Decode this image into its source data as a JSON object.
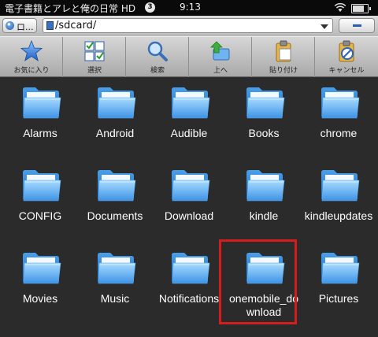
{
  "status_bar": {
    "title": "電子書籍とアレと俺の日常 HD",
    "badge": "3",
    "time": "9:13"
  },
  "address_bar": {
    "drive_label": "ロ...",
    "path": "/sdcard/"
  },
  "toolbar": {
    "buttons": [
      {
        "label": "お気に入り",
        "icon": "star-icon"
      },
      {
        "label": "選択",
        "icon": "checklist-icon"
      },
      {
        "label": "検索",
        "icon": "magnifier-icon"
      },
      {
        "label": "上へ",
        "icon": "up-folder-icon"
      },
      {
        "label": "貼り付け",
        "icon": "clipboard-icon"
      },
      {
        "label": "キャンセル",
        "icon": "cancel-icon"
      }
    ]
  },
  "folders": [
    {
      "name": "Alarms"
    },
    {
      "name": "Android"
    },
    {
      "name": "Audible"
    },
    {
      "name": "Books"
    },
    {
      "name": "chrome"
    },
    {
      "name": "CONFIG"
    },
    {
      "name": "Documents"
    },
    {
      "name": "Download"
    },
    {
      "name": "kindle"
    },
    {
      "name": "kindleupdates"
    },
    {
      "name": "Movies"
    },
    {
      "name": "Music"
    },
    {
      "name": "Notifications"
    },
    {
      "name": "onemobile_download",
      "selected": true
    },
    {
      "name": "Pictures"
    }
  ],
  "colors": {
    "background": "#2b2b2b",
    "selection_border": "#d61c1c",
    "folder_blue": "#4a9fe8"
  }
}
